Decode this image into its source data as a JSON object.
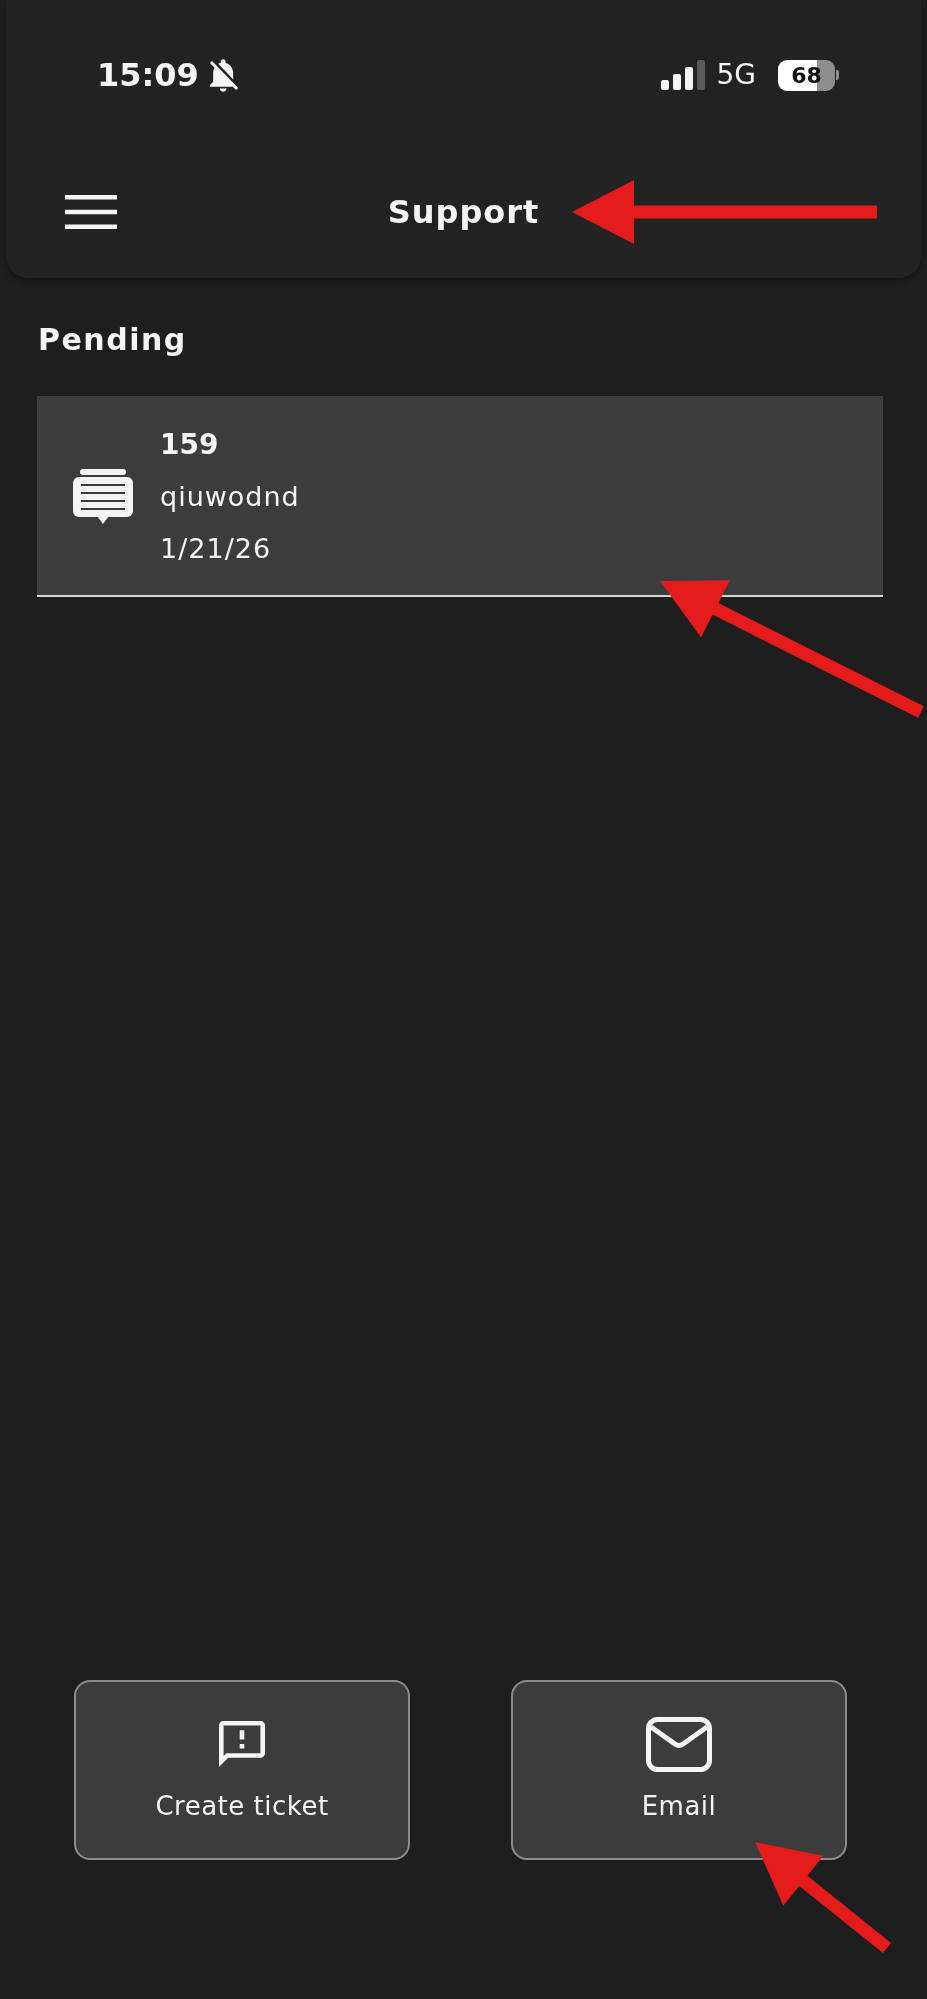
{
  "status_bar": {
    "time": "15:09",
    "silent": true,
    "network": "5G",
    "battery": "68"
  },
  "header": {
    "title": "Support"
  },
  "sections": [
    {
      "title": "Pending",
      "tickets": [
        {
          "number": "159",
          "subject": "qiuwodnd",
          "date": "1/21/26"
        }
      ]
    }
  ],
  "actions": [
    {
      "kind": "ticket",
      "label": "Create ticket"
    },
    {
      "kind": "email",
      "label": "Email"
    }
  ],
  "annotations": [
    {
      "kind": "arrow"
    },
    {
      "kind": "arrow"
    },
    {
      "kind": "arrow"
    }
  ]
}
